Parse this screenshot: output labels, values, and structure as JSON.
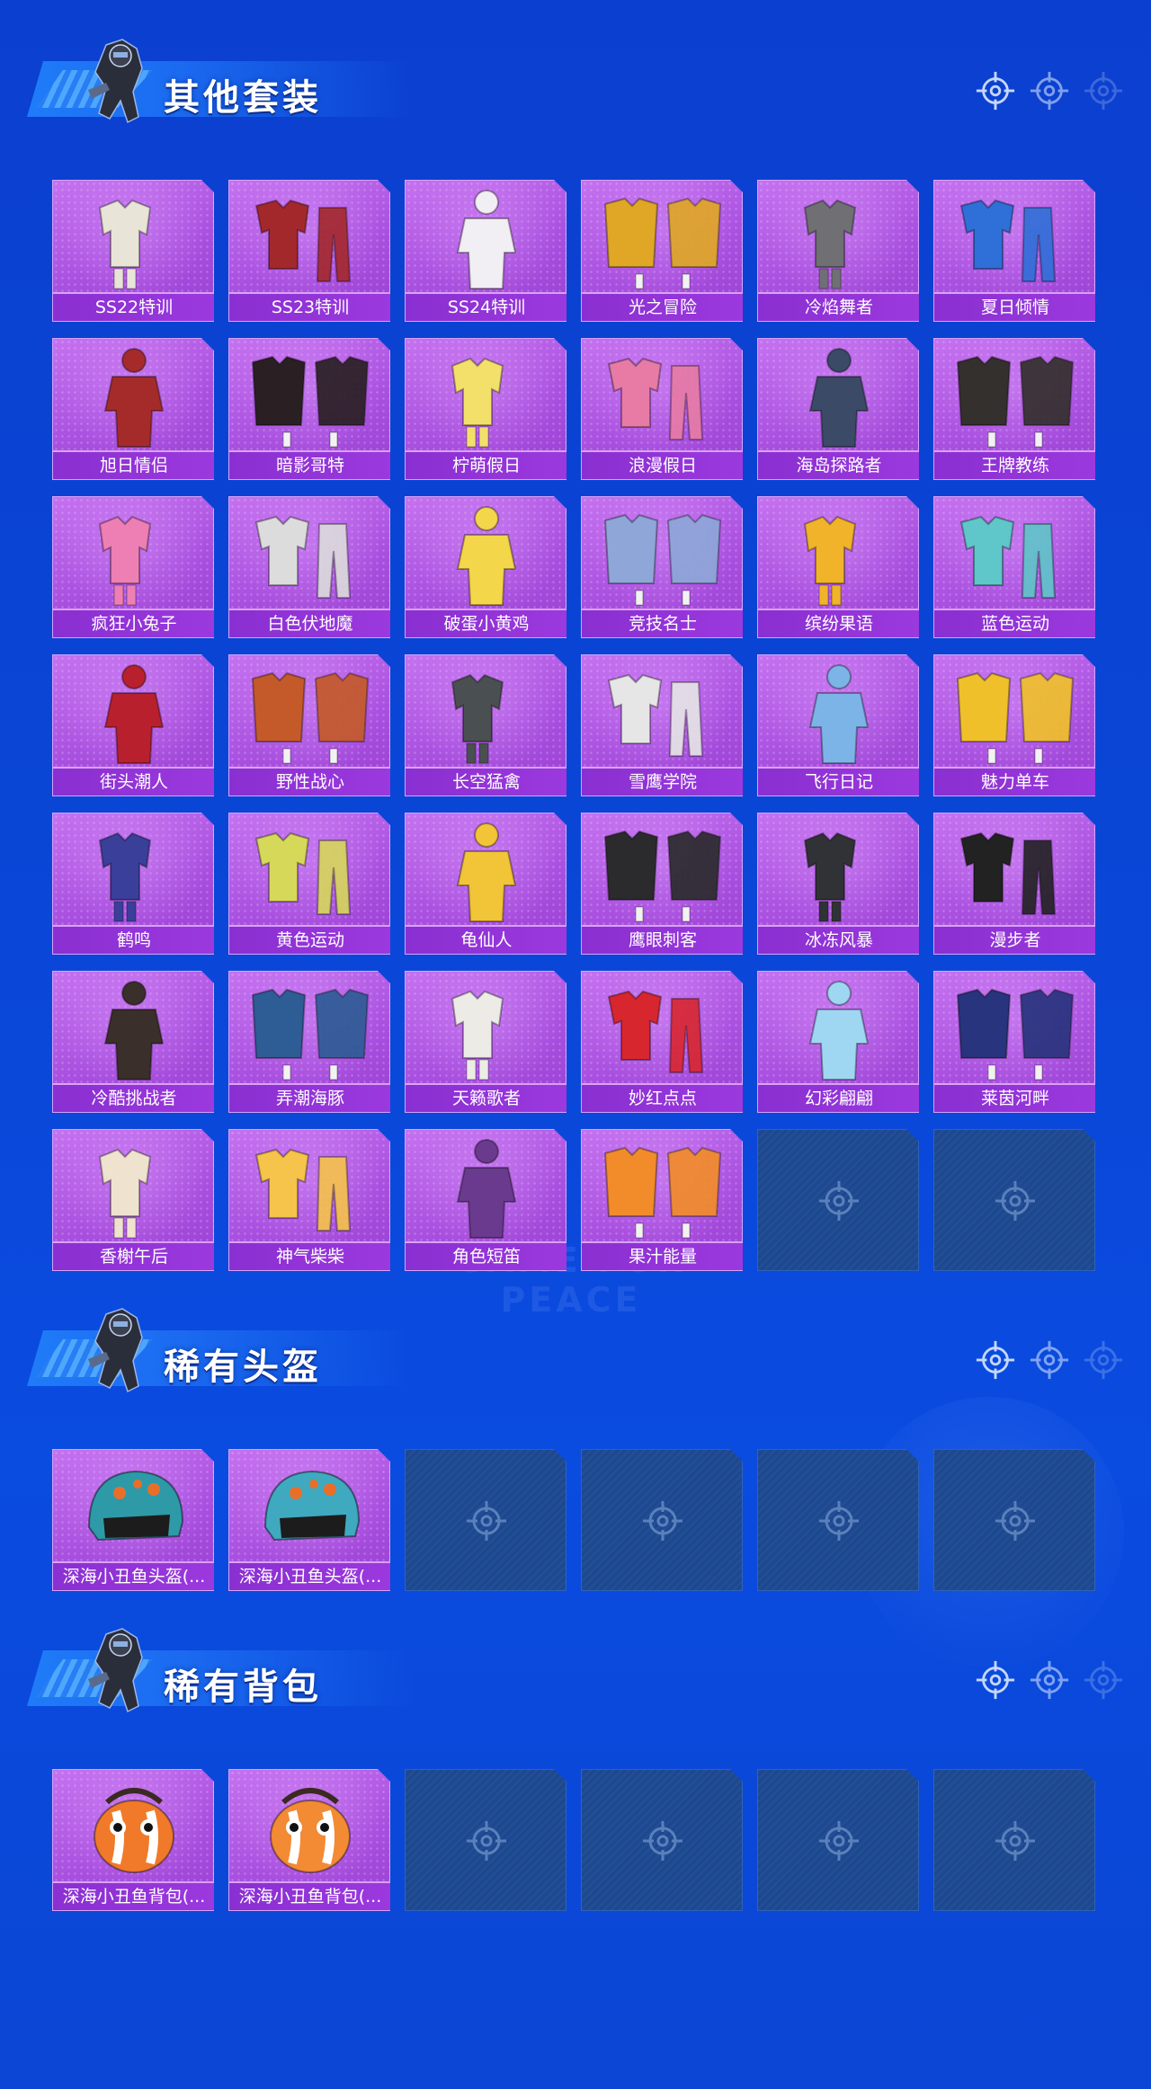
{
  "sections": [
    {
      "title": "其他套装",
      "items": [
        {
          "label": "SS22特训",
          "icon": "outfit-white-icon",
          "color": "#e8e4d8"
        },
        {
          "label": "SS23特训",
          "icon": "outfit-red-black-icon",
          "color": "#a3282c"
        },
        {
          "label": "SS24特训",
          "icon": "outfit-white-pink-icon",
          "color": "#f1eef4"
        },
        {
          "label": "光之冒险",
          "icon": "outfit-yellow-red-icon",
          "color": "#e0a726"
        },
        {
          "label": "冷焰舞者",
          "icon": "outfit-gray-coat-icon",
          "color": "#6f6f74"
        },
        {
          "label": "夏日倾情",
          "icon": "outfit-swimsuit-icon",
          "color": "#2f6fd8"
        },
        {
          "label": "旭日情侣",
          "icon": "outfit-red-hoodie-icon",
          "color": "#a52b2b"
        },
        {
          "label": "暗影哥特",
          "icon": "outfit-gothic-icon",
          "color": "#2a2024"
        },
        {
          "label": "柠萌假日",
          "icon": "outfit-lemon-dress-icon",
          "color": "#f3e06a"
        },
        {
          "label": "浪漫假日",
          "icon": "outfit-pink-suit-icon",
          "color": "#e87ba5"
        },
        {
          "label": "海岛探路者",
          "icon": "outfit-denim-icon",
          "color": "#3b4a66"
        },
        {
          "label": "王牌教练",
          "icon": "outfit-coach-icon",
          "color": "#34302e"
        },
        {
          "label": "疯狂小兔子",
          "icon": "outfit-bunny-icon",
          "color": "#ee7fb4"
        },
        {
          "label": "白色伏地魔",
          "icon": "outfit-white-hoodie-icon",
          "color": "#dcdcdc"
        },
        {
          "label": "破蛋小黄鸡",
          "icon": "outfit-chick-icon",
          "color": "#f4d64a"
        },
        {
          "label": "竞技名士",
          "icon": "outfit-blue-jacket-icon",
          "color": "#8ea7d8"
        },
        {
          "label": "缤纷果语",
          "icon": "outfit-fruit-dress-icon",
          "color": "#f0b32a"
        },
        {
          "label": "蓝色运动",
          "icon": "outfit-teal-sport-icon",
          "color": "#5fc6c9"
        },
        {
          "label": "街头潮人",
          "icon": "outfit-red-puffer-icon",
          "color": "#b8202e"
        },
        {
          "label": "野性战心",
          "icon": "outfit-orange-vest-icon",
          "color": "#c45a2a"
        },
        {
          "label": "长空猛禽",
          "icon": "outfit-camo-jacket-icon",
          "color": "#4a4f52"
        },
        {
          "label": "雪鹰学院",
          "icon": "outfit-school-icon",
          "color": "#e6e6e6"
        },
        {
          "label": "飞行日记",
          "icon": "outfit-flight-icon",
          "color": "#7db4e8"
        },
        {
          "label": "魅力单车",
          "icon": "outfit-yellow-shirt-icon",
          "color": "#f0c02b"
        },
        {
          "label": "鹤鸣",
          "icon": "outfit-purple-hoodie-icon",
          "color": "#3a3f9a"
        },
        {
          "label": "黄色运动",
          "icon": "outfit-yellow-jacket-icon",
          "color": "#d6d85a"
        },
        {
          "label": "龟仙人",
          "icon": "outfit-hawaiian-shirt-icon",
          "color": "#f2c437"
        },
        {
          "label": "鹰眼刺客",
          "icon": "outfit-black-leather-icon",
          "color": "#2b2b2d"
        },
        {
          "label": "冰冻风暴",
          "icon": "outfit-black-tactical-icon",
          "color": "#303236"
        },
        {
          "label": "漫步者",
          "icon": "outfit-black-pants-icon",
          "color": "#222222"
        },
        {
          "label": "冷酷挑战者",
          "icon": "outfit-dark-robe-icon",
          "color": "#3a2f2a"
        },
        {
          "label": "弄潮海豚",
          "icon": "outfit-dolphin-icon",
          "color": "#2e5c95"
        },
        {
          "label": "天籁歌者",
          "icon": "outfit-white-coat-icon",
          "color": "#ecebe6"
        },
        {
          "label": "妙红点点",
          "icon": "outfit-red-polka-icon",
          "color": "#d8262f"
        },
        {
          "label": "幻彩翩翩",
          "icon": "outfit-pastel-icon",
          "color": "#9fd7f3"
        },
        {
          "label": "莱茵河畔",
          "icon": "outfit-navy-plaid-icon",
          "color": "#28347d"
        },
        {
          "label": "香榭午后",
          "icon": "outfit-cream-icon",
          "color": "#efe2cf"
        },
        {
          "label": "神气柴柴",
          "icon": "outfit-shiba-icon",
          "color": "#f6c34b"
        },
        {
          "label": "角色短笛",
          "icon": "outfit-piccolo-icon",
          "color": "#6a3a8e"
        },
        {
          "label": "果汁能量",
          "icon": "outfit-orange-print-icon",
          "color": "#f28c2a"
        },
        {
          "empty": true
        },
        {
          "empty": true
        }
      ]
    },
    {
      "title": "稀有头盔",
      "items": [
        {
          "label": "深海小丑鱼头盔(...",
          "icon": "clownfish-helmet-icon",
          "color": "#2e9aa8"
        },
        {
          "label": "深海小丑鱼头盔(...",
          "icon": "clownfish-helmet-blue-icon",
          "color": "#3fa9c0"
        },
        {
          "empty": true
        },
        {
          "empty": true
        },
        {
          "empty": true
        },
        {
          "empty": true
        }
      ]
    },
    {
      "title": "稀有背包",
      "items": [
        {
          "label": "深海小丑鱼背包(...",
          "icon": "clownfish-backpack-icon",
          "color": "#f07a2a"
        },
        {
          "label": "深海小丑鱼背包(...",
          "icon": "clownfish-backpack-orange-icon",
          "color": "#f38a34"
        },
        {
          "empty": true
        },
        {
          "empty": true
        },
        {
          "empty": true
        },
        {
          "empty": true
        }
      ]
    }
  ],
  "watermark": "GAME FOR PEACE",
  "colors": {
    "background": "#0b44d6",
    "card_purple": "#a950e0",
    "card_label": "#8a2fd1",
    "empty_slot": "#1e4a93"
  }
}
